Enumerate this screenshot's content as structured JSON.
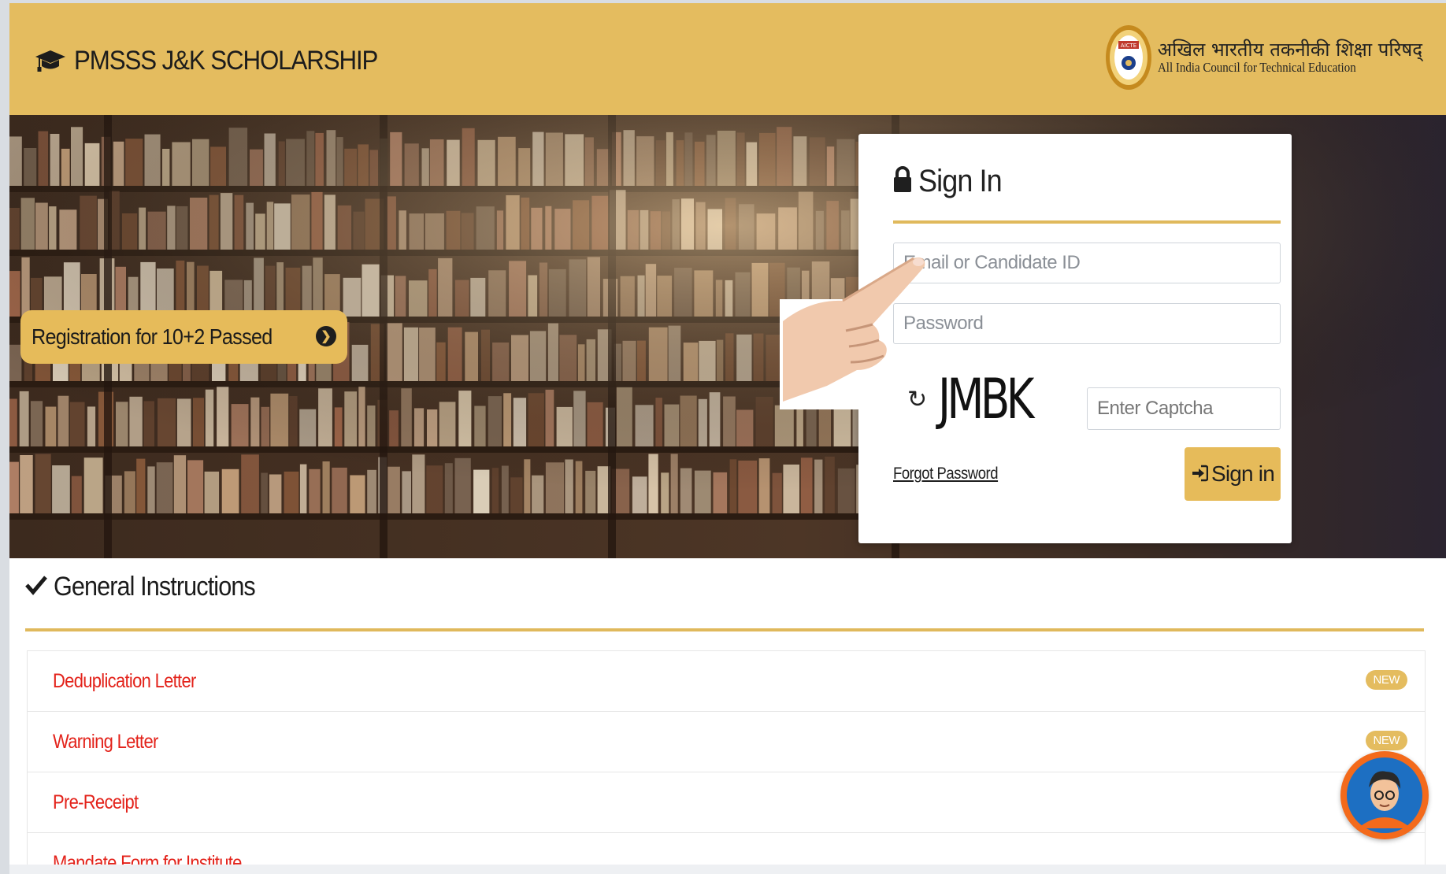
{
  "header": {
    "brand_icon": "graduation-cap-icon",
    "brand_title": "PMSSS J&K SCHOLARSHIP",
    "logo_hindi": "अखिल भारतीय तकनीकी शिक्षा परिषद्",
    "logo_english": "All India Council for Technical Education",
    "seal_text": "AICTE"
  },
  "hero": {
    "registration_label": "Registration for 10+2 Passed",
    "registration_icon": "chevron-circle-right-icon"
  },
  "signin": {
    "title": "Sign In",
    "title_icon": "lock-icon",
    "email_placeholder": "Email or Candidate ID",
    "password_placeholder": "Password",
    "captcha_text": "JMBK",
    "refresh_icon": "refresh-icon",
    "captcha_placeholder": "Enter Captcha",
    "forgot_label": "Forgot Password",
    "button_label": "Sign in",
    "button_icon": "sign-in-icon"
  },
  "instructions": {
    "title": "General Instructions",
    "title_icon": "checkmark-icon",
    "items": [
      {
        "label": "Deduplication Letter",
        "badge": "NEW"
      },
      {
        "label": "Warning Letter",
        "badge": "NEW"
      },
      {
        "label": "Pre-Receipt",
        "badge": ""
      },
      {
        "label": "Mandate Form for Institute",
        "badge": ""
      }
    ]
  },
  "colors": {
    "accent": "#e4bc5f",
    "link_red": "#e3221a",
    "avatar_orange": "#f36a1b"
  }
}
